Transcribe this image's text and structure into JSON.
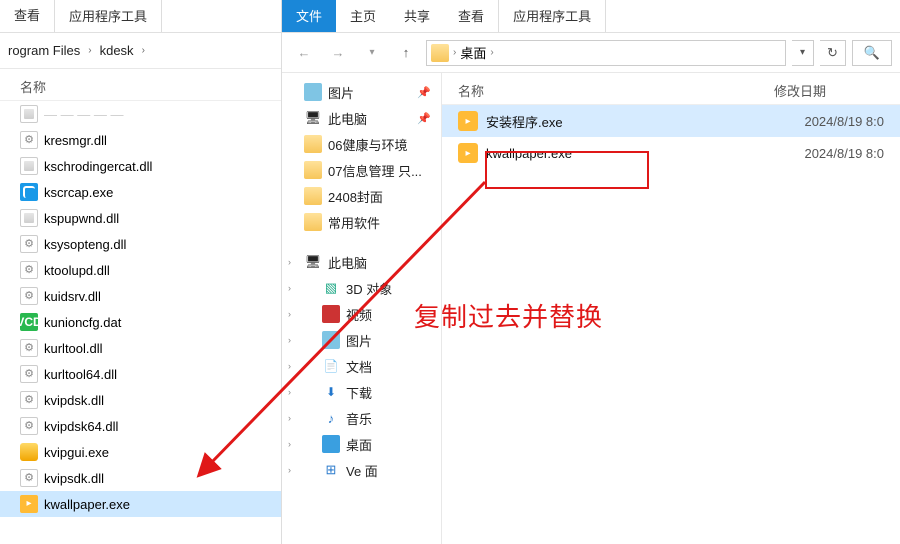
{
  "left": {
    "ribbon": {
      "view": "查看",
      "context": "应用程序工具"
    },
    "crumbs": {
      "seg1": "rogram Files",
      "seg2": "kdesk"
    },
    "column_name": "名称",
    "files": [
      {
        "name": "kresmgr.dll",
        "icon": "icn-gear"
      },
      {
        "name": "kschrodingercat.dll",
        "icon": "icn-dll"
      },
      {
        "name": "kscrcap.exe",
        "icon": "icn-blue"
      },
      {
        "name": "kspupwnd.dll",
        "icon": "icn-dll"
      },
      {
        "name": "ksysopteng.dll",
        "icon": "icn-gear"
      },
      {
        "name": "ktoolupd.dll",
        "icon": "icn-gear"
      },
      {
        "name": "kuidsrv.dll",
        "icon": "icn-gear"
      },
      {
        "name": "kunioncfg.dat",
        "icon": "icn-vcd"
      },
      {
        "name": "kurltool.dll",
        "icon": "icn-gear"
      },
      {
        "name": "kurltool64.dll",
        "icon": "icn-gear"
      },
      {
        "name": "kvipdsk.dll",
        "icon": "icn-gear"
      },
      {
        "name": "kvipdsk64.dll",
        "icon": "icn-gear"
      },
      {
        "name": "kvipgui.exe",
        "icon": "icn-yellow"
      },
      {
        "name": "kvipsdk.dll",
        "icon": "icn-gear"
      },
      {
        "name": "kwallpaper.exe",
        "icon": "icn-run",
        "selected": true
      }
    ]
  },
  "right": {
    "ribbon": {
      "file": "文件",
      "home": "主页",
      "share": "共享",
      "view": "查看",
      "context": "应用程序工具"
    },
    "addr_label": "桌面",
    "tree": {
      "quick": [
        {
          "label": "图片",
          "icon": "pic",
          "pinned": true
        },
        {
          "label": "此电脑",
          "icon": "pc",
          "pinned": true
        },
        {
          "label": "06健康与环境",
          "icon": "fold"
        },
        {
          "label": "07信息管理 只...",
          "icon": "fold"
        },
        {
          "label": "2408封面",
          "icon": "fold"
        },
        {
          "label": "常用软件",
          "icon": "fold"
        }
      ],
      "thispc_label": "此电脑",
      "thispc": [
        {
          "label": "3D 对象",
          "icon": "threeD"
        },
        {
          "label": "视频",
          "icon": "vid"
        },
        {
          "label": "图片",
          "icon": "pic"
        },
        {
          "label": "文档",
          "icon": "doc"
        },
        {
          "label": "下载",
          "icon": "dl"
        },
        {
          "label": "音乐",
          "icon": "mus"
        },
        {
          "label": "桌面",
          "icon": "desk"
        },
        {
          "label": "Ve 面",
          "icon": "win"
        }
      ]
    },
    "columns": {
      "name": "名称",
      "date": "修改日期"
    },
    "files": [
      {
        "name": "安装程序.exe",
        "date": "2024/8/19 8:0",
        "selected": true
      },
      {
        "name": "kwallpaper.exe",
        "date": "2024/8/19 8:0"
      }
    ]
  },
  "annotation_text": "复制过去并替换"
}
